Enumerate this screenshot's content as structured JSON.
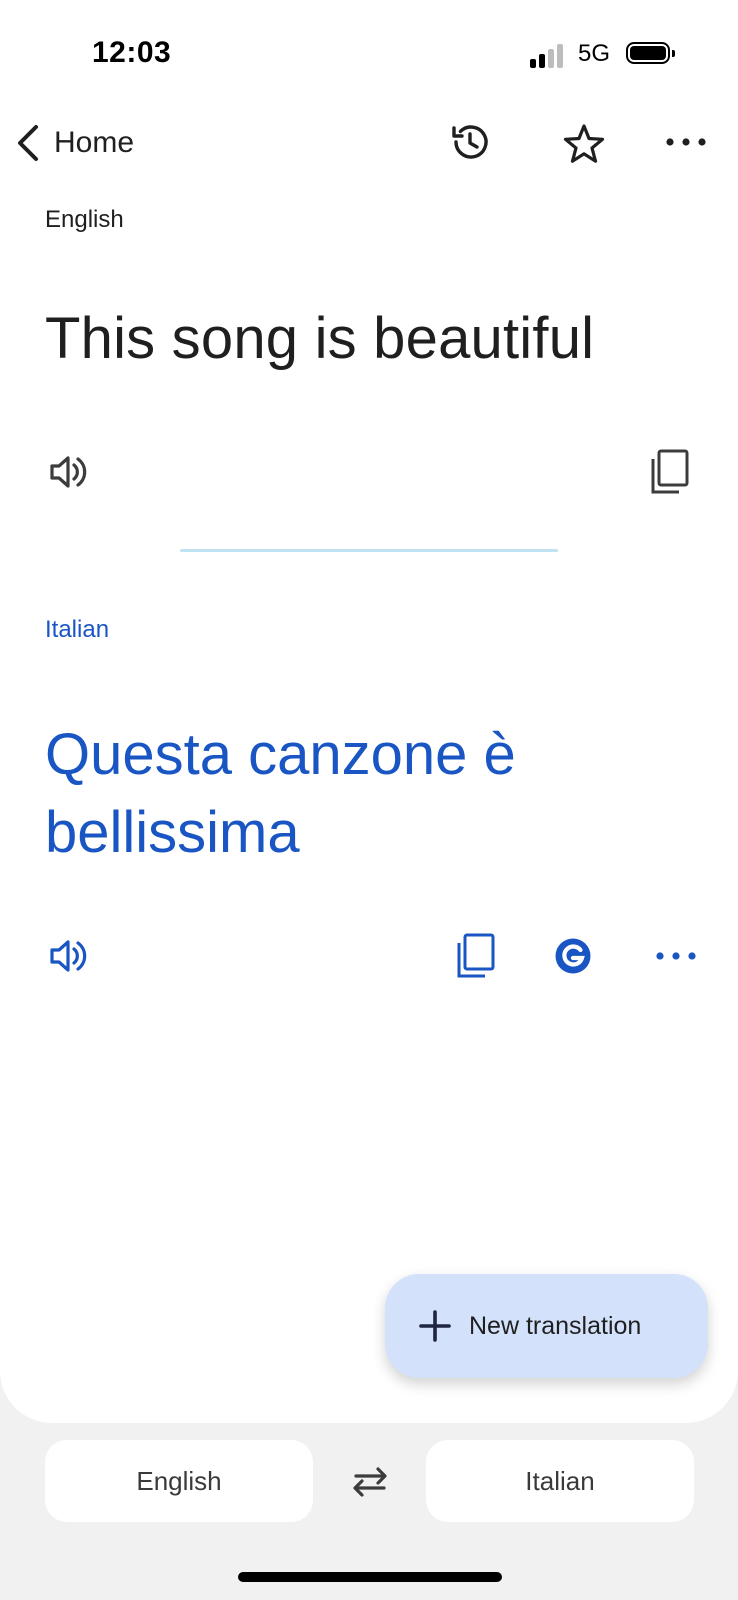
{
  "status_bar": {
    "time": "12:03",
    "network": "5G"
  },
  "header": {
    "back_label": "Home"
  },
  "source": {
    "language": "English",
    "text": "This song is beautiful"
  },
  "target": {
    "language": "Italian",
    "text": "Questa canzone è bellissima"
  },
  "fab": {
    "label": "New translation"
  },
  "bottom_bar": {
    "source_language": "English",
    "target_language": "Italian"
  },
  "colors": {
    "accent": "#1a55c4",
    "fab_bg": "#d3e1fb",
    "divider": "#bfe3f3",
    "background": "#f1f1f1"
  },
  "icons": [
    "chevron-left-icon",
    "history-icon",
    "star-icon",
    "more-icon",
    "speaker-icon",
    "copy-icon",
    "google-icon",
    "plus-icon",
    "swap-icon"
  ]
}
